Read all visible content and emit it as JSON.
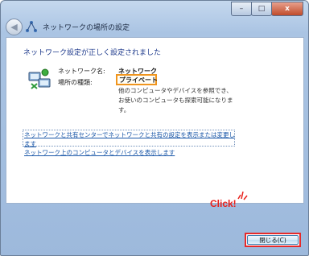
{
  "window": {
    "title": "ネットワークの場所の設定",
    "minimize_glyph": "–",
    "maximize_glyph": "□",
    "close_glyph": "x"
  },
  "content": {
    "heading": "ネットワーク設定が正しく設定されました",
    "network_name_label": "ネットワーク名:",
    "network_name_value": "ネットワーク",
    "location_type_label": "場所の種類:",
    "location_type_value": "プライベート",
    "description_line1": "他のコンピュータやデバイスを参照でき、",
    "description_line2": "お使いのコンピュータも探索可能になりま",
    "description_line3": "す。",
    "link1_line1": "ネットワークと共有センターでネットワークと共有の設定を表示または変更し",
    "link1_line2": "ます",
    "link2": "ネットワーク上のコンピュータとデバイスを表示します"
  },
  "footer": {
    "annotation": "Click!",
    "close_button_label": "閉じる(C)"
  },
  "colors": {
    "highlight_border": "#f0951e",
    "annotation_red": "#e8201a",
    "link_blue": "#1a57a8"
  }
}
